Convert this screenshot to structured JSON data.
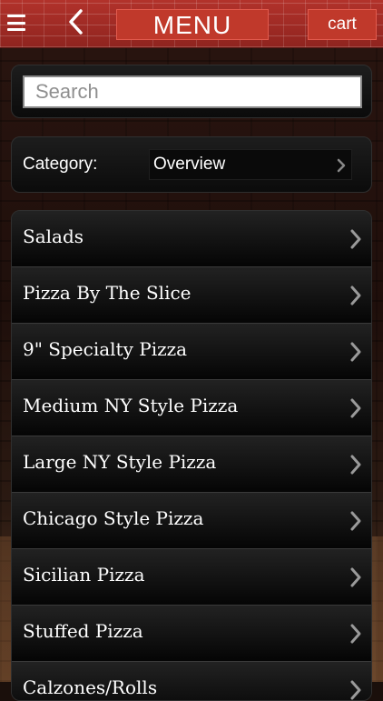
{
  "header": {
    "title": "MENU",
    "cart_label": "cart",
    "menu_icon": "hamburger-icon",
    "back_icon": "chevron-left-icon",
    "brand_color": "#c0392b"
  },
  "search": {
    "placeholder": "Search",
    "value": ""
  },
  "category": {
    "label": "Category:",
    "selected": "Overview"
  },
  "menu_items": [
    {
      "label": "Salads"
    },
    {
      "label": "Pizza By The Slice"
    },
    {
      "label": "9\" Specialty Pizza"
    },
    {
      "label": "Medium NY Style Pizza"
    },
    {
      "label": "Large NY Style Pizza"
    },
    {
      "label": "Chicago Style Pizza"
    },
    {
      "label": "Sicilian Pizza"
    },
    {
      "label": "Stuffed Pizza"
    },
    {
      "label": "Calzones/Rolls"
    }
  ]
}
